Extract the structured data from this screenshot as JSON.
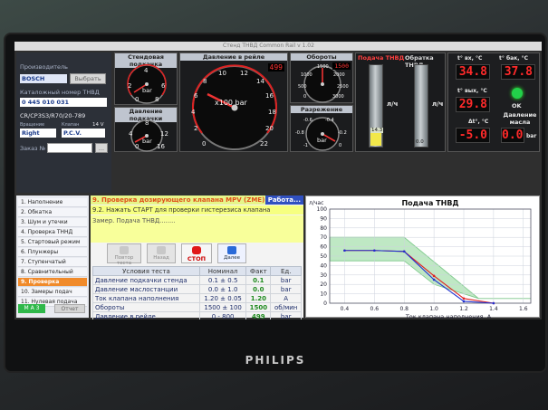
{
  "window": {
    "title": "Стенд ТНВД Common Rail v 1.02"
  },
  "brand": "PHILIPS",
  "info": {
    "manufacturer_label": "Производитель",
    "manufacturer": "BOSCH",
    "select_button": "Выбрать",
    "catalog_label": "Каталожный номер ТНВД",
    "catalog_number": "0 445 010 031",
    "model": "CR/CP3S3/R70/20-789",
    "rotation_label": "Вращение",
    "rotation": "Right",
    "valve_label": "Клапан",
    "valve_voltage": "14 V",
    "valve_type": "P.C.V.",
    "order_label": "Заказ №",
    "order_placeholder": "",
    "more_button": "..."
  },
  "gauges": {
    "feed": {
      "title": "Стендовая подкачка",
      "unit": "bar",
      "ticks": [
        "0",
        "2",
        "4",
        "6",
        "8"
      ]
    },
    "rail": {
      "title": "Давление в рейле",
      "unit": "x100 bar",
      "readout": "499",
      "ticks": [
        "0",
        "2",
        "4",
        "6",
        "8",
        "10",
        "12",
        "14",
        "16",
        "18",
        "20",
        "22"
      ]
    },
    "rpm": {
      "title": "Обороты",
      "readout": "1500",
      "ticks": [
        "0",
        "500",
        "1000",
        "1500",
        "2000",
        "2500",
        "3000"
      ]
    },
    "supply": {
      "title": "Давление подкачки",
      "unit": "bar",
      "readout": "",
      "ticks": [
        "0",
        "4",
        "8",
        "12",
        "16"
      ]
    },
    "vacuum": {
      "title": "Разрежение",
      "unit": "bar",
      "ticks": [
        "-1",
        "-0.8",
        "-0.6",
        "-0.4",
        "-0.2",
        "0"
      ]
    }
  },
  "flows": {
    "supply_title": "Подача ТНВД",
    "return_title": "Обратка ТНВД",
    "unit": "л/ч",
    "supply_value": "14.3",
    "return_value": "0.0",
    "supply_level": 0.2,
    "return_level": 0.0
  },
  "temps": {
    "t_in_label": "t° вх, °C",
    "t_in": "34.8",
    "t_tank_label": "t° бак, °C",
    "t_tank": "37.8",
    "t_out_label": "t° вых, °C",
    "t_out": "29.8",
    "ok_label": "OK",
    "delta_label": "Δt°, °C",
    "delta": "-5.0",
    "oil_label": "Давление масла",
    "oil": "0.0",
    "oil_unit": "bar"
  },
  "menu": {
    "items": [
      {
        "label": "1. Наполнение",
        "selected": false
      },
      {
        "label": "2. Обкатка",
        "selected": false
      },
      {
        "label": "3. Шум и утечки",
        "selected": false
      },
      {
        "label": "4. Проверка ТННД",
        "selected": false
      },
      {
        "label": "5. Стартовый режим",
        "selected": false
      },
      {
        "label": "6. Плунжеры",
        "selected": false
      },
      {
        "label": "7. Ступенчатый",
        "selected": false
      },
      {
        "label": "8. Сравнительный",
        "selected": false
      },
      {
        "label": "9. Проверка клапана",
        "selected": true
      },
      {
        "label": "10. Замеры подач",
        "selected": false
      },
      {
        "label": "11. Нулевая подача",
        "selected": false
      }
    ],
    "status": "M A 3",
    "report": "Отчет"
  },
  "test": {
    "header": "9. Проверка дозирующего клапана MPV (ZME)",
    "status": "Работа...",
    "step": "9.2. Нажать СТАРТ для проверки гистерезиса клапана",
    "measure": "Замер. Подача ТНВД........",
    "buttons": {
      "repeat": "Повтор теста",
      "back": "Назад",
      "stop": "СТОП",
      "next": "Далее"
    },
    "table": {
      "headers": [
        "Условия теста",
        "Номинал",
        "Факт",
        "Ед."
      ],
      "rows": [
        [
          "Давление подкачки стенда",
          "0.1 ± 0.5",
          "0.1",
          "bar"
        ],
        [
          "Давление маслостанции",
          "0.0 ± 1.0",
          "0.0",
          "bar"
        ],
        [
          "Ток клапана наполнения",
          "1.20 ± 0.05",
          "1.20",
          "A"
        ],
        [
          "Обороты",
          "1500 ± 100",
          "1500",
          "об/мин"
        ],
        [
          "Давление в рейле",
          "0 - 800",
          "499",
          "bar"
        ]
      ]
    }
  },
  "chart_data": {
    "type": "line",
    "title": "Подача ТНВД",
    "xlabel": "Ток клапана наполнения, А",
    "ylabel": "л/час",
    "xlim": [
      0.3,
      1.65
    ],
    "ylim": [
      0,
      100
    ],
    "xticks": [
      "0.4",
      "0.6",
      "0.8",
      "1.0",
      "1.2",
      "1.4",
      "1.6"
    ],
    "yticks": [
      "0",
      "10",
      "20",
      "30",
      "40",
      "50",
      "60",
      "70",
      "80",
      "90",
      "100"
    ],
    "tolerance_band": {
      "upper": [
        [
          0.3,
          70
        ],
        [
          0.8,
          70
        ],
        [
          1.3,
          5
        ],
        [
          1.65,
          5
        ]
      ],
      "lower": [
        [
          0.3,
          45
        ],
        [
          0.8,
          45
        ],
        [
          1.0,
          20
        ],
        [
          1.3,
          5
        ],
        [
          1.65,
          5
        ]
      ]
    },
    "series": [
      {
        "color": "#e02020",
        "x": [
          0.4,
          0.6,
          0.8,
          1.0,
          1.2,
          1.4
        ],
        "y": [
          56,
          56,
          55,
          29,
          5,
          0
        ]
      },
      {
        "color": "#2030d0",
        "x": [
          0.4,
          0.6,
          0.8,
          1.0,
          1.2,
          1.4
        ],
        "y": [
          56,
          56,
          55,
          25,
          2,
          0
        ]
      }
    ],
    "grid": true
  }
}
